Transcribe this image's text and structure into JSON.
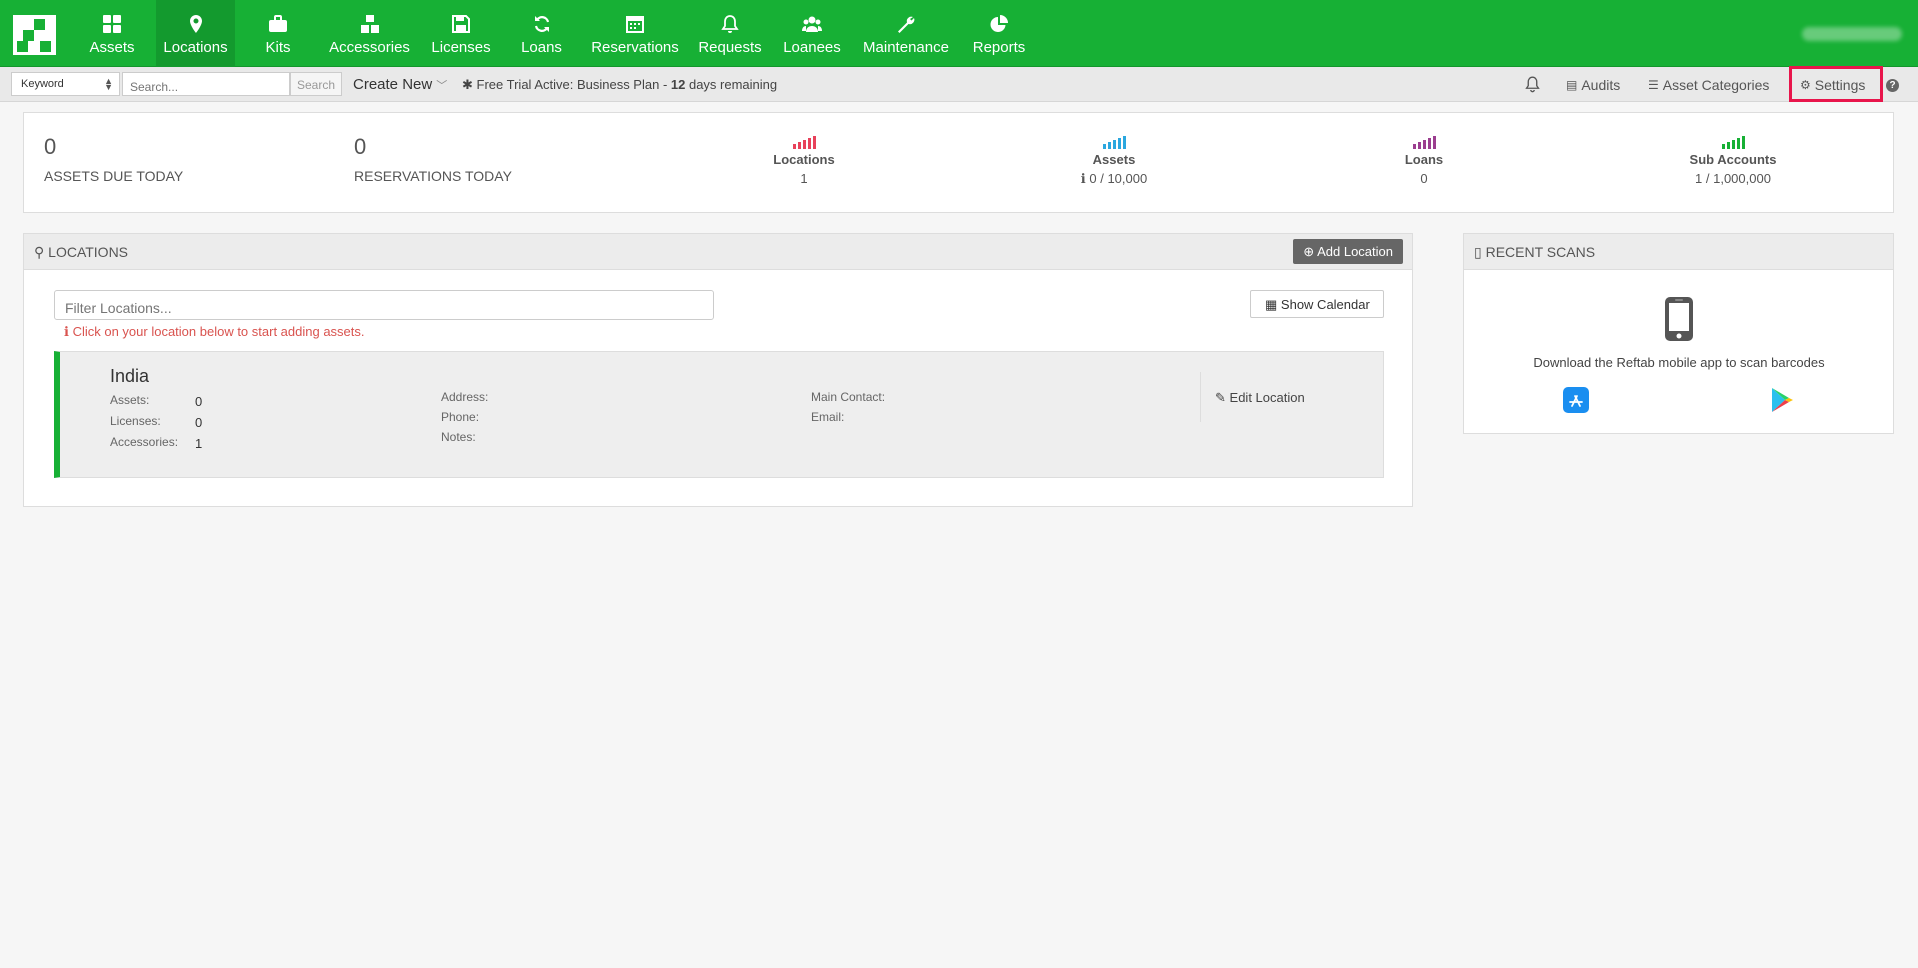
{
  "nav": {
    "items": [
      {
        "label": "Assets",
        "icon": "grid-icon"
      },
      {
        "label": "Locations",
        "icon": "map-marker-icon"
      },
      {
        "label": "Kits",
        "icon": "briefcase-icon"
      },
      {
        "label": "Accessories",
        "icon": "cubes-icon"
      },
      {
        "label": "Licenses",
        "icon": "floppy-icon"
      },
      {
        "label": "Loans",
        "icon": "refresh-icon"
      },
      {
        "label": "Reservations",
        "icon": "calendar-icon"
      },
      {
        "label": "Requests",
        "icon": "bell-icon"
      },
      {
        "label": "Loanees",
        "icon": "users-icon"
      },
      {
        "label": "Maintenance",
        "icon": "wrench-icon"
      },
      {
        "label": "Reports",
        "icon": "pie-chart-icon"
      }
    ],
    "active": "Locations",
    "brand_color": "#17b035"
  },
  "subbar": {
    "keyword_select": "Keyword",
    "search_placeholder": "Search...",
    "search_button": "Search",
    "create_new": "Create New",
    "trial_prefix": "Free Trial Active: Business Plan - ",
    "trial_days": "12",
    "trial_suffix": " days remaining",
    "audits": "Audits",
    "asset_categories": "Asset Categories",
    "settings": "Settings",
    "help": "?"
  },
  "stats": {
    "assets_due_today": {
      "value": "0",
      "label": "ASSETS DUE TODAY"
    },
    "reservations_today": {
      "value": "0",
      "label": "RESERVATIONS TODAY"
    },
    "locations": {
      "title": "Locations",
      "value": "1",
      "color": "#e8415a"
    },
    "assets": {
      "title": "Assets",
      "value": "0 / 10,000",
      "color": "#2aa7df"
    },
    "loans": {
      "title": "Loans",
      "value": "0",
      "color": "#9b3d8f"
    },
    "sub_accounts": {
      "title": "Sub Accounts",
      "value": "1 / 1,000,000",
      "color": "#17b035"
    }
  },
  "locations_panel": {
    "title": "LOCATIONS",
    "add_button": "Add Location",
    "filter_placeholder": "Filter Locations...",
    "show_calendar": "Show Calendar",
    "hint": "Click on your location below to start adding assets.",
    "location": {
      "name": "India",
      "assets_label": "Assets:",
      "assets": "0",
      "licenses_label": "Licenses:",
      "licenses": "0",
      "accessories_label": "Accessories:",
      "accessories": "1",
      "address_label": "Address:",
      "phone_label": "Phone:",
      "notes_label": "Notes:",
      "main_contact_label": "Main Contact:",
      "email_label": "Email:",
      "edit": "Edit Location"
    }
  },
  "recent_scans": {
    "title": "RECENT SCANS",
    "text": "Download the Reftab mobile app to scan barcodes"
  }
}
